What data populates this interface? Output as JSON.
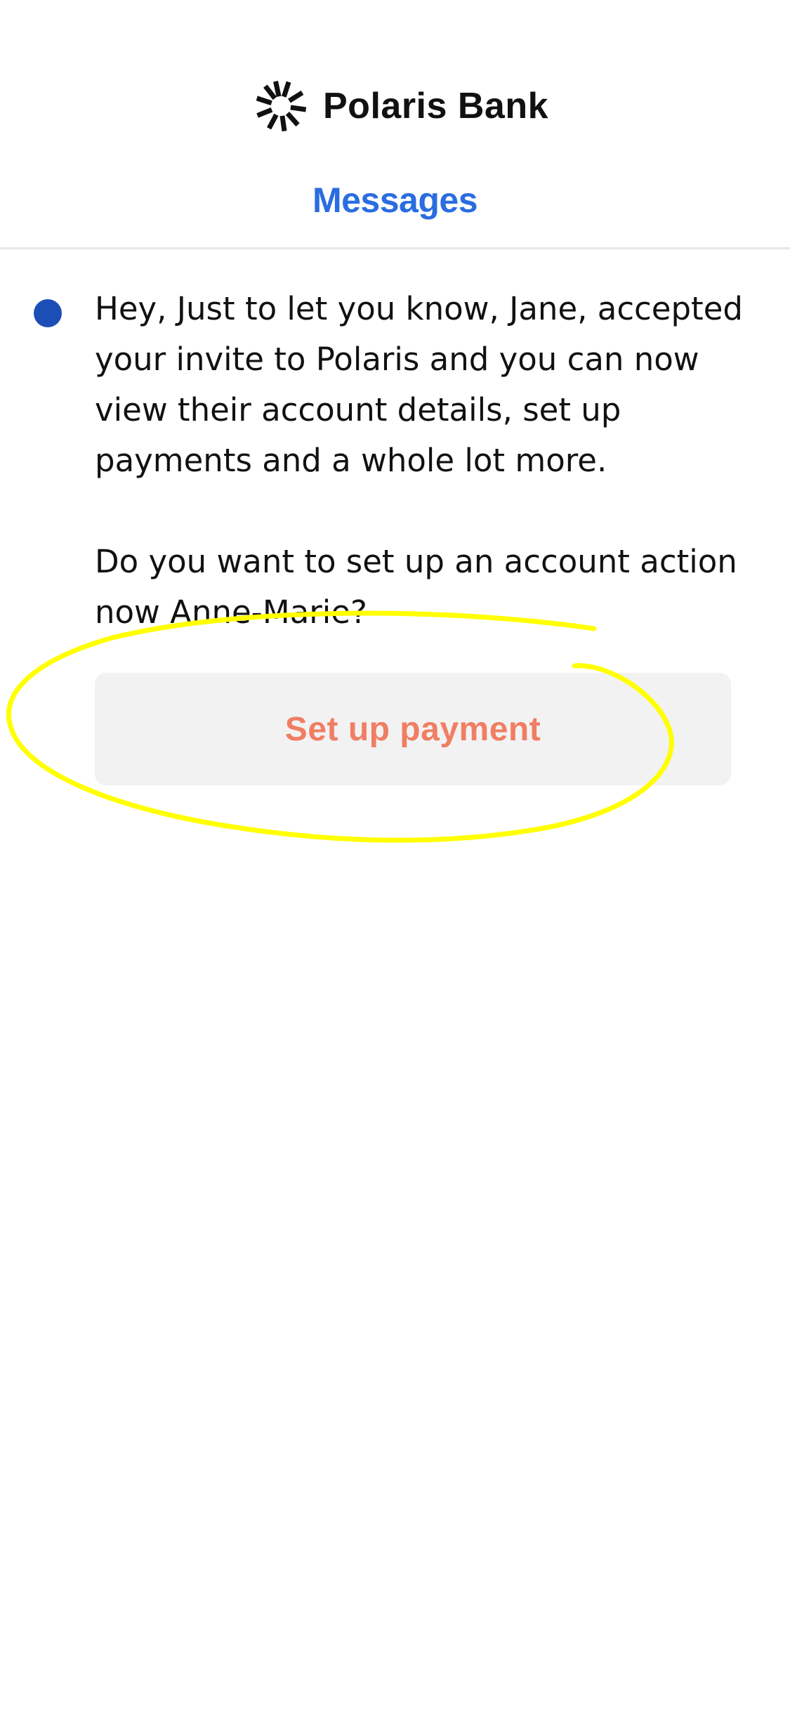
{
  "header": {
    "brand_name": "Polaris Bank",
    "logo_icon": "sunburst-logo-icon",
    "title": "Messages"
  },
  "message": {
    "unread": true,
    "paragraphs": [
      "Hey, Just to let you know, Jane, accepted your invite to Polaris and you can now view their account details, set up payments and a whole lot more.",
      "Do you want to set up an account action now Anne-Marie?"
    ]
  },
  "action": {
    "label": "Set up payment"
  },
  "colors": {
    "accent_title": "#2a6de0",
    "unread_dot": "#1d4eb5",
    "button_text": "#f07e63",
    "button_bg": "#f2f2f2",
    "annotation_highlight": "#ffff00"
  }
}
